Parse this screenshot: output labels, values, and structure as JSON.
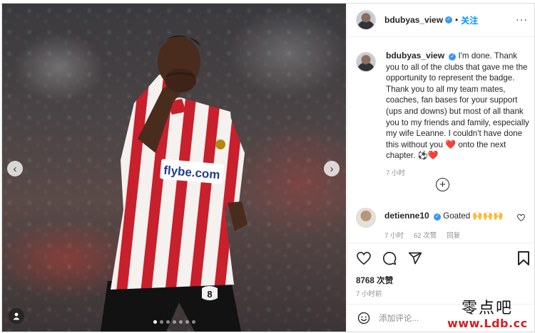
{
  "post": {
    "username": "bdubyas_view",
    "follow_label": "关注",
    "separator": "•",
    "more_label": "···",
    "caption_text": "I'm done. Thank you to all of the clubs that gave me the opportunity to represent the badge. Thank you to all my team mates, coaches, fan bases for your support (ups and downs) but most of all thank you to my friends and family, especially my wife Leanne. I couldn't have done this without you",
    "caption_heart": "❤️",
    "caption_tail": " onto the next chapter. ⚽",
    "caption_heart_end": "❤️",
    "caption_time": "7 小时",
    "load_more_icon": "plus-circle-icon",
    "jersey_text": "flybe.com",
    "jersey_number": "8"
  },
  "comment": {
    "username": "detienne10",
    "text": "Goated 🙌🙌🙌",
    "time": "7 小时",
    "likes": "62 次赞",
    "reply": "回复"
  },
  "actions": {
    "likes_count": "8768 次赞",
    "posted_time": "7 小时前",
    "icons": [
      "heart-icon",
      "comment-icon",
      "share-icon",
      "bookmark-icon"
    ]
  },
  "add_comment": {
    "placeholder": "添加评论...",
    "emoji_icon": "emoji-icon"
  },
  "carousel": {
    "prev": "‹",
    "next": "›",
    "dots": 7,
    "active_dot": 0
  },
  "watermark": {
    "chinese": "零点吧",
    "url": "www.Ldb.cc"
  },
  "colors": {
    "accent": "#0095f6",
    "verified": "#3897f0",
    "heart": "#ed1c24",
    "muted": "#8e8e8e",
    "text": "#262626"
  }
}
